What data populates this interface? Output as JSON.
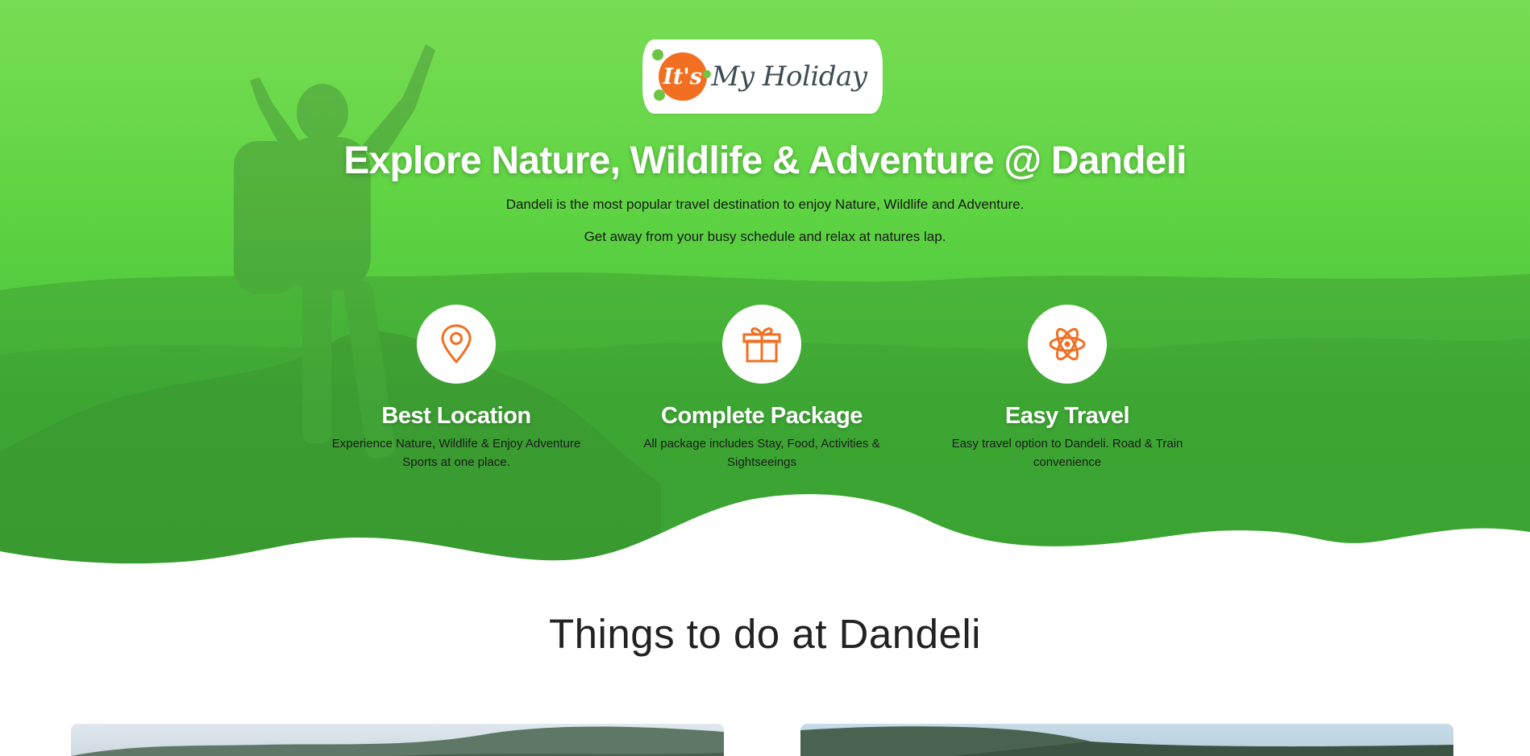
{
  "logo": {
    "mark_text": "It's",
    "wordmark": "My Holiday"
  },
  "hero": {
    "headline": "Explore Nature, Wildlife & Adventure @ Dandeli",
    "subline_1": "Dandeli is the most popular travel destination to enjoy Nature, Wildlife and Adventure.",
    "subline_2": "Get away from your busy schedule and relax at natures lap."
  },
  "features": [
    {
      "icon": "map-pin-icon",
      "title": "Best Location",
      "description": "Experience Nature, Wildlife & Enjoy Adventure Sports at one place."
    },
    {
      "icon": "gift-icon",
      "title": "Complete Package",
      "description": "All package includes Stay, Food, Activities & Sightseeings"
    },
    {
      "icon": "atom-icon",
      "title": "Easy Travel",
      "description": "Easy travel option to Dandeli. Road & Train convenience"
    }
  ],
  "things_to_do": {
    "title": "Things to do at Dandeli"
  },
  "colors": {
    "hero_green": "#5fd443",
    "accent_orange": "#f26f21",
    "logo_dot_green": "#6cc644"
  }
}
